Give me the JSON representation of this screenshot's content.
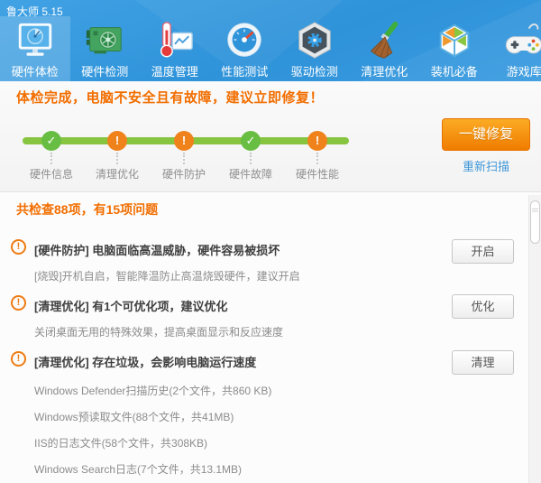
{
  "window": {
    "title": "鲁大师 5.15"
  },
  "nav": {
    "tabs": [
      {
        "label": "硬件体检",
        "icon": "monitor-scan-icon",
        "active": true
      },
      {
        "label": "硬件检测",
        "icon": "gpu-card-icon",
        "active": false
      },
      {
        "label": "温度管理",
        "icon": "thermometer-chart-icon",
        "active": false
      },
      {
        "label": "性能测试",
        "icon": "speed-gauge-icon",
        "active": false
      },
      {
        "label": "驱动检测",
        "icon": "gear-hexagon-icon",
        "active": false
      },
      {
        "label": "清理优化",
        "icon": "broom-icon",
        "active": false
      },
      {
        "label": "装机必备",
        "icon": "cube-box-icon",
        "active": false
      },
      {
        "label": "游戏库",
        "icon": "gamepad-icon",
        "active": false
      }
    ]
  },
  "banner": {
    "message": "体检完成，电脑不安全且有故障，建议立即修复！",
    "fix_button": "一键修复",
    "rescan_link": "重新扫描"
  },
  "timeline": {
    "steps": [
      {
        "label": "硬件信息",
        "status": "ok"
      },
      {
        "label": "清理优化",
        "status": "warn"
      },
      {
        "label": "硬件防护",
        "status": "warn"
      },
      {
        "label": "硬件故障",
        "status": "ok"
      },
      {
        "label": "硬件性能",
        "status": "warn"
      }
    ]
  },
  "summary": {
    "text": "共检查88项，有15项问题"
  },
  "issues": [
    {
      "title": "[硬件防护] 电脑面临高温威胁，硬件容易被损坏",
      "action": "开启",
      "details": [
        "[烧毁]开机自启，智能降温防止高温烧毁硬件，建议开启"
      ]
    },
    {
      "title": "[清理优化] 有1个可优化项，建议优化",
      "action": "优化",
      "details": [
        "关闭桌面无用的特殊效果，提高桌面显示和反应速度"
      ]
    },
    {
      "title": "[清理优化] 存在垃圾，会影响电脑运行速度",
      "action": "清理",
      "details": [
        "Windows Defender扫描历史(2个文件，共860 KB)",
        "Windows预读取文件(88个文件，共41MB)",
        "IIS的日志文件(58个文件，共308KB)",
        "Windows Search日志(7个文件，共13.1MB)"
      ]
    }
  ],
  "colors": {
    "header_blue": "#3498dc",
    "accent_orange": "#f26e00",
    "button_orange": "#f07c00",
    "ok_green": "#68bd43",
    "warn_orange": "#f0821c",
    "timeline_green": "#87c540",
    "link_blue": "#3e97d8"
  }
}
